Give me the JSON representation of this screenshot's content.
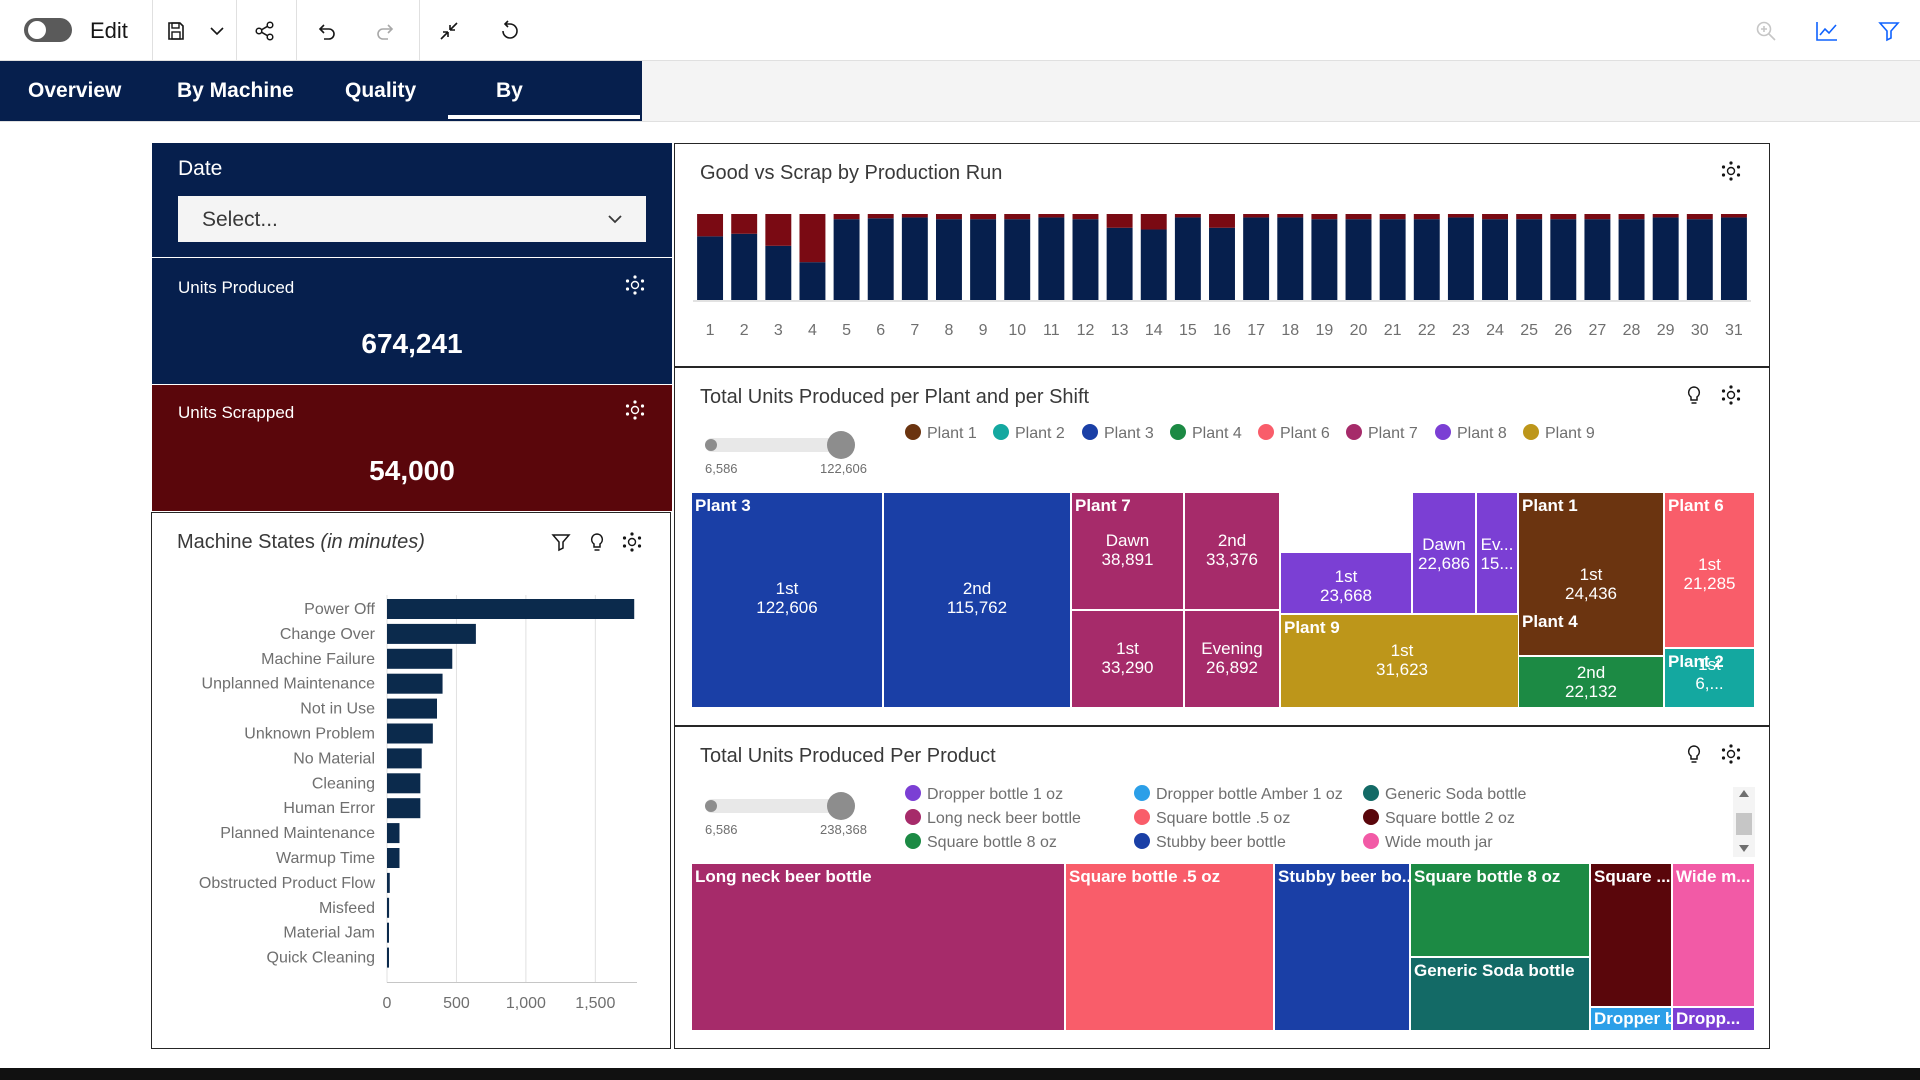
{
  "toolbar": {
    "edit_label": "Edit",
    "icons": [
      "toggle-switch",
      "save-icon",
      "chevron-down-icon",
      "share-icon",
      "undo-icon",
      "redo-icon",
      "collapse-icon",
      "reset-icon",
      "zoom-icon",
      "line-chart-icon",
      "filter-icon"
    ]
  },
  "tabs": [
    {
      "label": "Overview"
    },
    {
      "label": "By Machine"
    },
    {
      "label": "Quality"
    },
    {
      "label": "By Production",
      "active": true
    }
  ],
  "date_filter": {
    "label": "Date",
    "placeholder": "Select..."
  },
  "kpis": {
    "units_produced": {
      "label": "Units Produced",
      "value": "674,241",
      "bg": "#061f4d"
    },
    "units_scrapped": {
      "label": "Units Scrapped",
      "value": "54,000",
      "bg": "#5a060b"
    }
  },
  "machine_states": {
    "title": "Machine States",
    "title_suffix": "(in minutes)",
    "chart_data": {
      "type": "bar",
      "orientation": "horizontal",
      "categories": [
        "Power Off",
        "Change Over",
        "Machine Failure",
        "Unplanned Maintenance",
        "Not in Use",
        "Unknown Problem",
        "No Material",
        "Cleaning",
        "Human Error",
        "Planned Maintenance",
        "Warmup Time",
        "Obstructed Product Flow",
        "Misfeed",
        "Material Jam",
        "Quick Cleaning"
      ],
      "values": [
        1780,
        640,
        470,
        400,
        360,
        330,
        250,
        240,
        240,
        90,
        90,
        20,
        15,
        12,
        10
      ],
      "xlim": [
        0,
        1800
      ],
      "ticks": [
        0,
        500,
        1000,
        1500
      ],
      "tick_labels": [
        "0",
        "500",
        "1,000",
        "1,500"
      ],
      "color": "#0b2a4c",
      "grid": true
    }
  },
  "good_vs_scrap": {
    "title": "Good vs Scrap by Production Run",
    "chart_data": {
      "type": "bar",
      "stacked": true,
      "categories": [
        "1",
        "2",
        "3",
        "4",
        "5",
        "6",
        "7",
        "8",
        "9",
        "10",
        "11",
        "12",
        "13",
        "14",
        "15",
        "16",
        "17",
        "18",
        "19",
        "20",
        "21",
        "22",
        "23",
        "24",
        "25",
        "26",
        "27",
        "28",
        "29",
        "30",
        "31"
      ],
      "series": [
        {
          "name": "Good",
          "color": "#061f4d",
          "values": [
            74,
            77,
            63,
            44,
            94,
            95,
            96,
            94,
            94,
            94,
            96,
            94,
            84,
            82,
            96,
            84,
            96,
            96,
            94,
            94,
            94,
            94,
            96,
            94,
            94,
            94,
            94,
            94,
            96,
            94,
            96
          ]
        },
        {
          "name": "Scrap",
          "color": "#7a0a13",
          "values": [
            26,
            23,
            37,
            56,
            6,
            5,
            4,
            6,
            6,
            6,
            4,
            6,
            16,
            18,
            4,
            16,
            4,
            4,
            6,
            6,
            6,
            6,
            4,
            6,
            6,
            6,
            6,
            6,
            4,
            6,
            4
          ]
        }
      ],
      "ylim": [
        0,
        100
      ]
    }
  },
  "plant_shift": {
    "title": "Total Units Produced per Plant and per Shift",
    "range": {
      "min": "6,586",
      "max": "122,606"
    },
    "legend": [
      {
        "label": "Plant 1",
        "color": "#6b3410"
      },
      {
        "label": "Plant 2",
        "color": "#14a8a0"
      },
      {
        "label": "Plant 3",
        "color": "#1a3fa6"
      },
      {
        "label": "Plant 4",
        "color": "#1c8a44"
      },
      {
        "label": "Plant 6",
        "color": "#f95d6a"
      },
      {
        "label": "Plant 7",
        "color": "#a62b6a"
      },
      {
        "label": "Plant 8",
        "color": "#7b3fd4"
      },
      {
        "label": "Plant 9",
        "color": "#bd961a"
      }
    ],
    "chart_data": {
      "type": "treemap",
      "groups": [
        {
          "name": "Plant 3",
          "color": "#1a3fa6",
          "items": [
            {
              "shift": "1st",
              "value": 122606,
              "label": "122,606"
            },
            {
              "shift": "2nd",
              "value": 115762,
              "label": "115,762"
            }
          ]
        },
        {
          "name": "Plant 7",
          "color": "#a62b6a",
          "items": [
            {
              "shift": "Dawn",
              "value": 38891,
              "label": "38,891"
            },
            {
              "shift": "2nd",
              "value": 33376,
              "label": "33,376"
            },
            {
              "shift": "1st",
              "value": 33290,
              "label": "33,290"
            },
            {
              "shift": "Evening",
              "value": 26892,
              "label": "26,892"
            }
          ]
        },
        {
          "name": "Plant 8",
          "color": "#7b3fd4",
          "items": [
            {
              "shift": "1st",
              "value": 23668,
              "label": "23,668"
            },
            {
              "shift": "Dawn",
              "value": 22686,
              "label": "22,686"
            },
            {
              "shift": "Ev...",
              "value": 15000,
              "label": "15..."
            }
          ]
        },
        {
          "name": "Plant 9",
          "color": "#bd961a",
          "items": [
            {
              "shift": "1st",
              "value": 31623,
              "label": "31,623"
            }
          ]
        },
        {
          "name": "Plant 1",
          "color": "#6b3410",
          "items": [
            {
              "shift": "1st",
              "value": 24436,
              "label": "24,436"
            }
          ]
        },
        {
          "name": "Plant 4",
          "color": "#1c8a44",
          "items": [
            {
              "shift": "2nd",
              "value": 22132,
              "label": "22,132"
            }
          ]
        },
        {
          "name": "Plant 6",
          "color": "#f95d6a",
          "items": [
            {
              "shift": "1st",
              "value": 21285,
              "label": "21,285"
            }
          ]
        },
        {
          "name": "Plant 2",
          "color": "#14a8a0",
          "items": [
            {
              "shift": "1st",
              "value": 6586,
              "label": "6,..."
            }
          ]
        }
      ]
    }
  },
  "per_product": {
    "title": "Total Units Produced Per Product",
    "range": {
      "min": "6,586",
      "max": "238,368"
    },
    "legend": [
      {
        "label": "Dropper bottle 1 oz",
        "color": "#7b3fd4"
      },
      {
        "label": "Dropper bottle Amber 1 oz",
        "color": "#2b9fe8"
      },
      {
        "label": "Generic Soda bottle",
        "color": "#136a66"
      },
      {
        "label": "Long neck beer bottle",
        "color": "#a62b6a"
      },
      {
        "label": "Square bottle .5 oz",
        "color": "#f95d6a"
      },
      {
        "label": "Square bottle 2 oz",
        "color": "#5a060b"
      },
      {
        "label": "Square bottle 8 oz",
        "color": "#1c8a44"
      },
      {
        "label": "Stubby beer bottle",
        "color": "#1a3fa6"
      },
      {
        "label": "Wide mouth jar",
        "color": "#f25aa6"
      }
    ],
    "chart_data": {
      "type": "treemap",
      "items": [
        {
          "label": "Long neck beer bottle",
          "value": 238368,
          "color": "#a62b6a"
        },
        {
          "label": "Square bottle .5 oz",
          "value": 135000,
          "color": "#f95d6a"
        },
        {
          "label": "Stubby beer bo...",
          "value": 85000,
          "color": "#1a3fa6"
        },
        {
          "label": "Square bottle 8 oz",
          "value": 70000,
          "color": "#1c8a44"
        },
        {
          "label": "Generic Soda bottle",
          "value": 50000,
          "color": "#136a66"
        },
        {
          "label": "Square ...",
          "value": 40000,
          "color": "#5a060b"
        },
        {
          "label": "Wide m...",
          "value": 38000,
          "color": "#f25aa6"
        },
        {
          "label": "Dropper b...",
          "value": 9000,
          "color": "#2b9fe8"
        },
        {
          "label": "Dropp...",
          "value": 6586,
          "color": "#7b3fd4"
        }
      ]
    }
  }
}
